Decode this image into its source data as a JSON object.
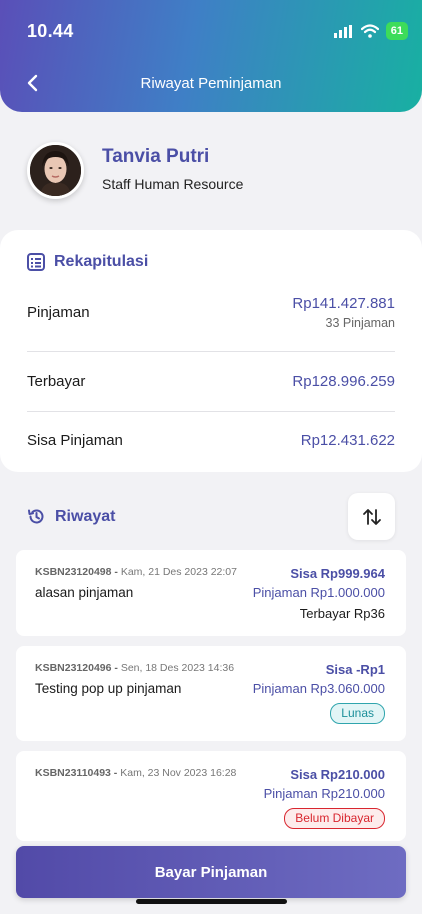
{
  "status_bar": {
    "time": "10.44",
    "battery": "61",
    "icons": [
      "signal-icon",
      "wifi-icon",
      "battery-icon"
    ]
  },
  "header": {
    "title": "Riwayat Peminjaman",
    "back_icon": "back-arrow-icon"
  },
  "profile": {
    "name": "Tanvia Putri",
    "role": "Staff Human Resource"
  },
  "rekap": {
    "title": "Rekapitulasi",
    "rows": [
      {
        "label": "Pinjaman",
        "value": "Rp141.427.881",
        "sub": "33 Pinjaman"
      },
      {
        "label": "Terbayar",
        "value": "Rp128.996.259"
      },
      {
        "label": "Sisa Pinjaman",
        "value": "Rp12.431.622"
      }
    ]
  },
  "riwayat": {
    "title": "Riwayat",
    "items": [
      {
        "code": "KSBN23120498 -",
        "date": "Kam, 21 Des 2023 22:07",
        "desc": "alasan pinjaman",
        "sisa": "Sisa Rp999.964",
        "pinjaman": "Pinjaman Rp1.000.000",
        "terbayar": "Terbayar Rp36"
      },
      {
        "code": "KSBN23120496 -",
        "date": "Sen, 18 Des 2023 14:36",
        "desc": "Testing pop up pinjaman",
        "sisa": "Sisa -Rp1",
        "pinjaman": "Pinjaman Rp3.060.000",
        "badge": "Lunas"
      },
      {
        "code": "KSBN23110493 -",
        "date": "Kam, 23 Nov 2023 16:28",
        "desc": "",
        "sisa": "Sisa Rp210.000",
        "pinjaman": "Pinjaman Rp210.000",
        "badge": "Belum Dibayar"
      }
    ]
  },
  "pay_button": "Bayar Pinjaman",
  "colors": {
    "accent": "#4b4fa6",
    "header_start": "#5a4fb8",
    "header_end": "#18b0a2",
    "lunas": "#2fa5ad",
    "belum": "#d8262f"
  }
}
